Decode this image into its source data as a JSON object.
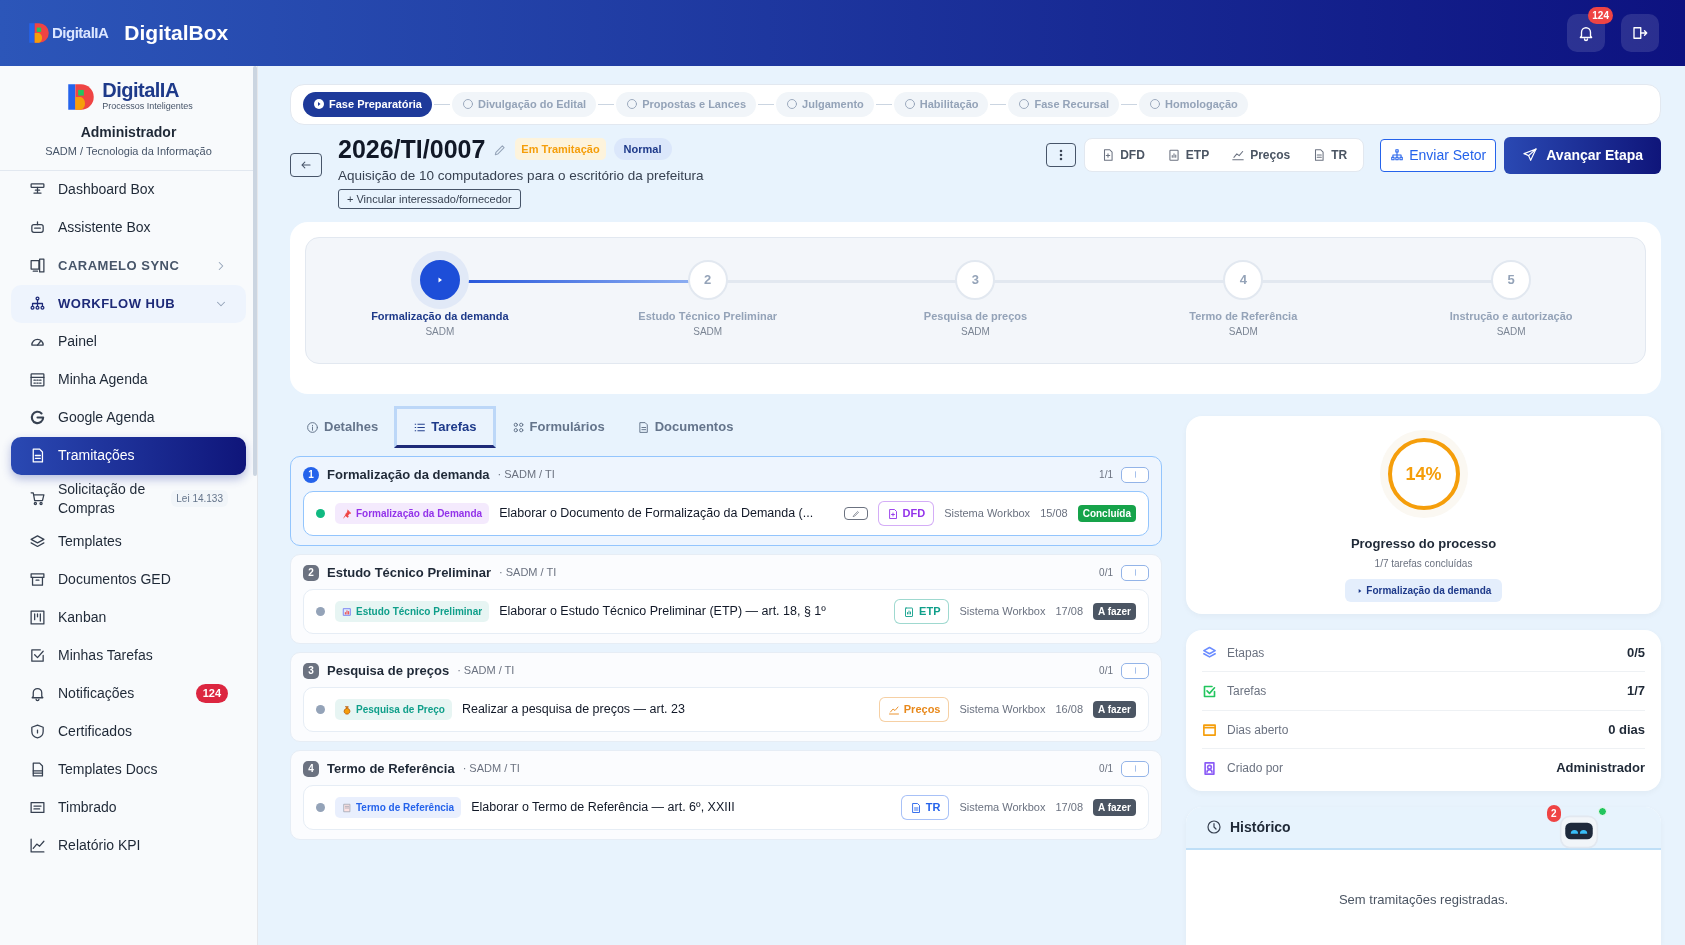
{
  "topbar": {
    "logo": "DigitalIA",
    "title": "DigitalBox",
    "notifications": "124"
  },
  "sidebar": {
    "logo": "DigitalIA",
    "tagline": "Processos Inteligentes",
    "user": "Administrador",
    "department": "SADM / Tecnologia da Informação",
    "items": [
      {
        "label": "Dashboard Box",
        "kind": "link",
        "selected": false
      },
      {
        "label": "Assistente Box",
        "kind": "link",
        "selected": false
      },
      {
        "label": "CARAMELO SYNC",
        "kind": "section",
        "expanded": false,
        "selected": false
      },
      {
        "label": "WORKFLOW HUB",
        "kind": "section",
        "expanded": true,
        "selected": false
      },
      {
        "label": "Painel",
        "kind": "link",
        "selected": false
      },
      {
        "label": "Minha Agenda",
        "kind": "link",
        "selected": false
      },
      {
        "label": "Google Agenda",
        "kind": "link",
        "selected": false
      },
      {
        "label": "Tramitações",
        "kind": "link",
        "selected": true
      },
      {
        "label": "Solicitação de Compras",
        "kind": "link",
        "selected": false,
        "tag": "Lei 14.133"
      },
      {
        "label": "Templates",
        "kind": "link",
        "selected": false
      },
      {
        "label": "Documentos GED",
        "kind": "link",
        "selected": false
      },
      {
        "label": "Kanban",
        "kind": "link",
        "selected": false
      },
      {
        "label": "Minhas Tarefas",
        "kind": "link",
        "selected": false
      },
      {
        "label": "Notificações",
        "kind": "link",
        "selected": false,
        "count": "124"
      },
      {
        "label": "Certificados",
        "kind": "link",
        "selected": false
      },
      {
        "label": "Templates Docs",
        "kind": "link",
        "selected": false
      },
      {
        "label": "Timbrado",
        "kind": "link",
        "selected": false
      },
      {
        "label": "Relatório KPI",
        "kind": "link",
        "selected": false
      }
    ]
  },
  "phases": [
    {
      "label": "Fase Preparatória",
      "selected": true
    },
    {
      "label": "Divulgação do Edital",
      "selected": false
    },
    {
      "label": "Propostas e Lances",
      "selected": false
    },
    {
      "label": "Julgamento",
      "selected": false
    },
    {
      "label": "Habilitação",
      "selected": false
    },
    {
      "label": "Fase Recursal",
      "selected": false
    },
    {
      "label": "Homologação",
      "selected": false
    }
  ],
  "process": {
    "code": "2026/TI/0007",
    "status": "Em Tramitação",
    "priority": "Normal",
    "description": "Aquisição de 10 computadores para o escritório da prefeitura",
    "link_button": "+ Vincular interessado/fornecedor",
    "documents": [
      "DFD",
      "ETP",
      "Preços",
      "TR"
    ],
    "send_button": "Enviar Setor",
    "advance_button": "Avançar Etapa"
  },
  "steps": [
    {
      "label": "Formalização da demanda",
      "sector": "SADM",
      "current": true
    },
    {
      "number": "2",
      "label": "Estudo Técnico Preliminar",
      "sector": "SADM",
      "current": false
    },
    {
      "number": "3",
      "label": "Pesquisa de preços",
      "sector": "SADM",
      "current": false
    },
    {
      "number": "4",
      "label": "Termo de Referência",
      "sector": "SADM",
      "current": false
    },
    {
      "number": "5",
      "label": "Instrução e autorização",
      "sector": "SADM",
      "current": false
    }
  ],
  "tabs": [
    {
      "label": "Detalhes",
      "selected": false
    },
    {
      "label": "Tarefas",
      "selected": true
    },
    {
      "label": "Formulários",
      "selected": false
    },
    {
      "label": "Documentos",
      "selected": false
    }
  ],
  "task_groups": [
    {
      "number": "1",
      "title": "Formalização da demanda",
      "sector": "· SADM / TI",
      "count": "1/1",
      "active": true,
      "tasks": [
        {
          "tag": {
            "label": "Formalização da Demanda",
            "color": "#9333ea"
          },
          "title": "Elaborar o Documento de Formalização da Demanda (...",
          "editable": true,
          "doc": {
            "label": "DFD",
            "color": "#9333ea"
          },
          "owner": "Sistema Workbox",
          "date": "15/08",
          "status": "Concluída",
          "done": true
        }
      ]
    },
    {
      "number": "2",
      "title": "Estudo Técnico Preliminar",
      "sector": "· SADM / TI",
      "count": "0/1",
      "active": false,
      "tasks": [
        {
          "tag": {
            "label": "Estudo Técnico Preliminar",
            "color": "#0f9f8a"
          },
          "title": "Elaborar o Estudo Técnico Preliminar (ETP) — art. 18, § 1º",
          "editable": false,
          "doc": {
            "label": "ETP",
            "color": "#0f9f8a"
          },
          "owner": "Sistema Workbox",
          "date": "17/08",
          "status": "A fazer",
          "done": false
        }
      ]
    },
    {
      "number": "3",
      "title": "Pesquisa de preços",
      "sector": "· SADM / TI",
      "count": "0/1",
      "active": false,
      "tasks": [
        {
          "tag": {
            "label": "Pesquisa de Preço",
            "color": "#0f9f8a"
          },
          "title": "Realizar a pesquisa de preços — art. 23",
          "editable": false,
          "doc": {
            "label": "Preços",
            "color": "#e8891c"
          },
          "owner": "Sistema Workbox",
          "date": "16/08",
          "status": "A fazer",
          "done": false
        }
      ]
    },
    {
      "number": "4",
      "title": "Termo de Referência",
      "sector": "· SADM / TI",
      "count": "0/1",
      "active": false,
      "tasks": [
        {
          "tag": {
            "label": "Termo de Referência",
            "color": "#2563eb"
          },
          "title": "Elaborar o Termo de Referência — art. 6º, XXIII",
          "editable": false,
          "doc": {
            "label": "TR",
            "color": "#2563eb"
          },
          "owner": "Sistema Workbox",
          "date": "17/08",
          "status": "A fazer",
          "done": false
        }
      ]
    }
  ],
  "progress": {
    "percent": "14%",
    "title": "Progresso do processo",
    "subtitle": "1/7 tarefas concluídas",
    "current_step": "Formalização da demanda"
  },
  "stats": [
    {
      "label": "Etapas",
      "value": "0/5",
      "color": "#6b8cff"
    },
    {
      "label": "Tarefas",
      "value": "1/7",
      "color": "#22c55e"
    },
    {
      "label": "Dias aberto",
      "value": "0 dias",
      "color": "#f59e0b"
    },
    {
      "label": "Criado por",
      "value": "Administrador",
      "color": "#8b5cf6"
    }
  ],
  "history": {
    "title": "Histórico",
    "empty": "Sem tramitações registradas."
  },
  "assistant": {
    "unread": "2",
    "online": true
  }
}
